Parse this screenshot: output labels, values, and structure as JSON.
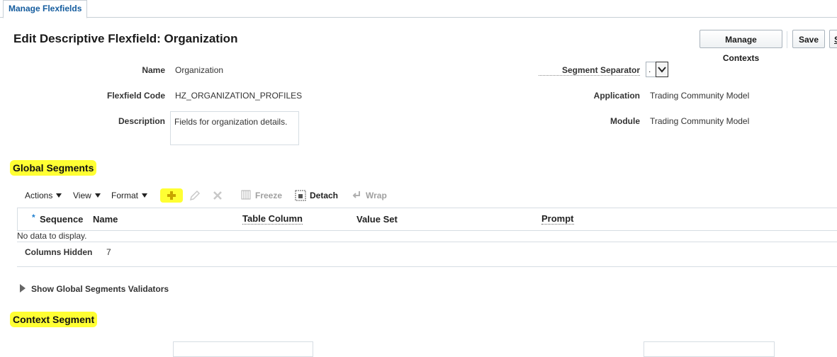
{
  "tabs": [
    {
      "label": "Manage Flexfields"
    }
  ],
  "page": {
    "title": "Edit Descriptive Flexfield: Organization"
  },
  "buttons": {
    "manage_contexts": "Manage Contexts",
    "save": "Save",
    "save_close_partial": "S"
  },
  "form": {
    "name_label": "Name",
    "name_value": "Organization",
    "code_label": "Flexfield Code",
    "code_value": "HZ_ORGANIZATION_PROFILES",
    "description_label": "Description",
    "description_value": "Fields for organization details.",
    "separator_label": "Segment Separator",
    "separator_value": ".",
    "application_label": "Application",
    "application_value": "Trading Community Model",
    "module_label": "Module",
    "module_value": "Trading Community Model"
  },
  "global_segments": {
    "heading": "Global Segments",
    "toolbar": {
      "actions": "Actions",
      "view": "View",
      "format": "Format",
      "freeze": "Freeze",
      "detach": "Detach",
      "wrap": "Wrap"
    },
    "columns": {
      "required_marker": "*",
      "sequence": "Sequence",
      "name": "Name",
      "table_column": "Table Column",
      "value_set": "Value Set",
      "prompt": "Prompt"
    },
    "empty_text": "No data to display.",
    "columns_hidden_label": "Columns Hidden",
    "columns_hidden_value": "7",
    "validators_label": "Show Global Segments Validators"
  },
  "context_segment": {
    "heading": "Context Segment"
  },
  "colors": {
    "highlight": "#ffff33",
    "link": "#145c9e",
    "add_icon": "#c8a400"
  }
}
